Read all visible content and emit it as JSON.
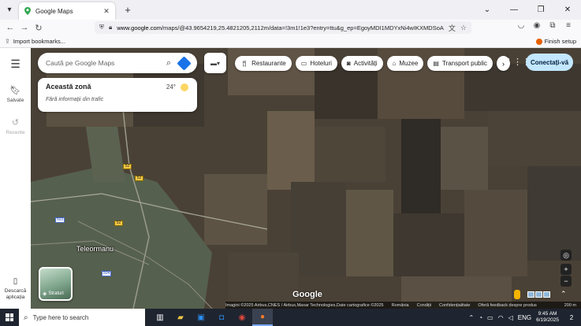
{
  "browser": {
    "tab_title": "Google Maps",
    "url_host": "www.google.com",
    "url_path": "/maps/@43.9654219,25.4821205,2112m/data=!3m1!1e3?entry=ttu&g_ep=EgoyMDI1MDYxNi4wIKXMDSoASAFQAw%3D%3D",
    "bookmark_import": "Import bookmarks...",
    "finish_setup": "Finish setup"
  },
  "sidebar": {
    "saved_label": "Salvate",
    "recent_label": "Recente",
    "download_label": "Descarcă aplicația"
  },
  "search": {
    "placeholder": "Caută pe Google Maps"
  },
  "chips": [
    {
      "label": "Restaurante",
      "icon": "fork-knife-icon"
    },
    {
      "label": "Hoteluri",
      "icon": "bed-icon"
    },
    {
      "label": "Activități",
      "icon": "camera-icon"
    },
    {
      "label": "Muzee",
      "icon": "museum-icon"
    },
    {
      "label": "Transport public",
      "icon": "train-icon"
    }
  ],
  "signin_label": "Conectați-vă",
  "weather": {
    "zone": "Această zonă",
    "temp": "24°",
    "traffic": "Fără informații din trafic"
  },
  "map": {
    "town": "Teleormanu",
    "roads": [
      "52",
      "52",
      "52",
      "503",
      "504"
    ],
    "layer_label": "Straturi",
    "logo": "Google"
  },
  "attribution": {
    "imagery": "Imagini ©2025 Airbus,CNES / Airbus,Maxar Technologies,Date cartografice ©2025",
    "country": "România",
    "terms": "Condiții",
    "privacy": "Confidențialitate",
    "feedback": "Oferă feedback despre produs",
    "scale": "200 m"
  },
  "taskbar": {
    "search_text": "Type here to search",
    "lang": "ENG",
    "time": "9:45 AM",
    "date": "6/19/2025",
    "notif_count": "2"
  },
  "colors": {
    "accent": "#1a73e8",
    "signin_bg": "#c2e7ff",
    "sun": "#fdd663"
  }
}
